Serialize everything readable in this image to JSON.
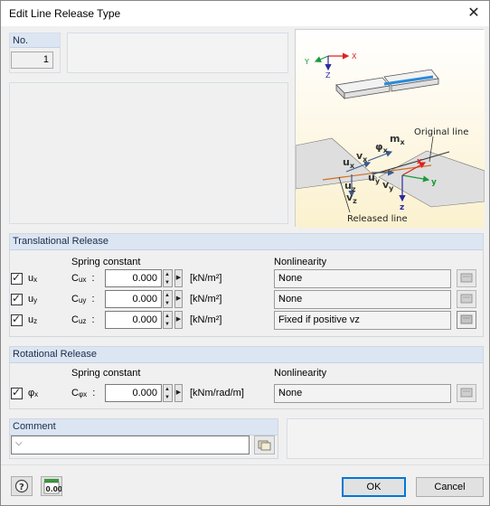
{
  "window": {
    "title": "Edit Line Release Type",
    "close_icon": "close-icon"
  },
  "no": {
    "label": "No.",
    "value": "1"
  },
  "figure": {
    "original_line": "Original line",
    "released_line": "Released line",
    "axes_top": {
      "x": "X",
      "y": "Y",
      "z": "Z"
    },
    "axes_bottom": {
      "x": "x",
      "y": "y",
      "z": "z"
    },
    "symbols": {
      "mx": "m",
      "mx_sub": "x",
      "phix": "φ",
      "phix_sub": "x",
      "ux": "u",
      "ux_sub": "x",
      "vx": "v",
      "vx_sub": "x",
      "uy": "u",
      "uy_sub": "y",
      "vy": "v",
      "vy_sub": "y",
      "uz": "u",
      "uz_sub": "z",
      "vz": "v",
      "vz_sub": "z"
    }
  },
  "translational": {
    "title": "Translational Release",
    "spring_header": "Spring constant",
    "nonlinearity_header": "Nonlinearity",
    "rows": [
      {
        "check": "u",
        "check_sub": "x",
        "const": "C",
        "const_sub": "ux",
        "value": "0.000",
        "unit": "[kN/m²]",
        "nonlinearity": "None"
      },
      {
        "check": "u",
        "check_sub": "y",
        "const": "C",
        "const_sub": "uy",
        "value": "0.000",
        "unit": "[kN/m²]",
        "nonlinearity": "None"
      },
      {
        "check": "u",
        "check_sub": "z",
        "const": "C",
        "const_sub": "uz",
        "value": "0.000",
        "unit": "[kN/m²]",
        "nonlinearity": "Fixed if positive vz"
      }
    ]
  },
  "rotational": {
    "title": "Rotational Release",
    "spring_header": "Spring constant",
    "nonlinearity_header": "Nonlinearity",
    "row": {
      "check": "φ",
      "check_sub": "x",
      "const": "C",
      "const_sub": "φx",
      "value": "0.000",
      "unit": "[kNm/rad/m]",
      "nonlinearity": "None"
    }
  },
  "comment": {
    "title": "Comment",
    "value": ""
  },
  "footer": {
    "ok": "OK",
    "cancel": "Cancel",
    "units_icon_label": "0.00"
  },
  "colors": {
    "group_header": "#dce6f3",
    "axis_x": "#e02020",
    "axis_y": "#1a9a3a",
    "axis_z": "#2a2aa0",
    "release_line": "#d07020"
  }
}
